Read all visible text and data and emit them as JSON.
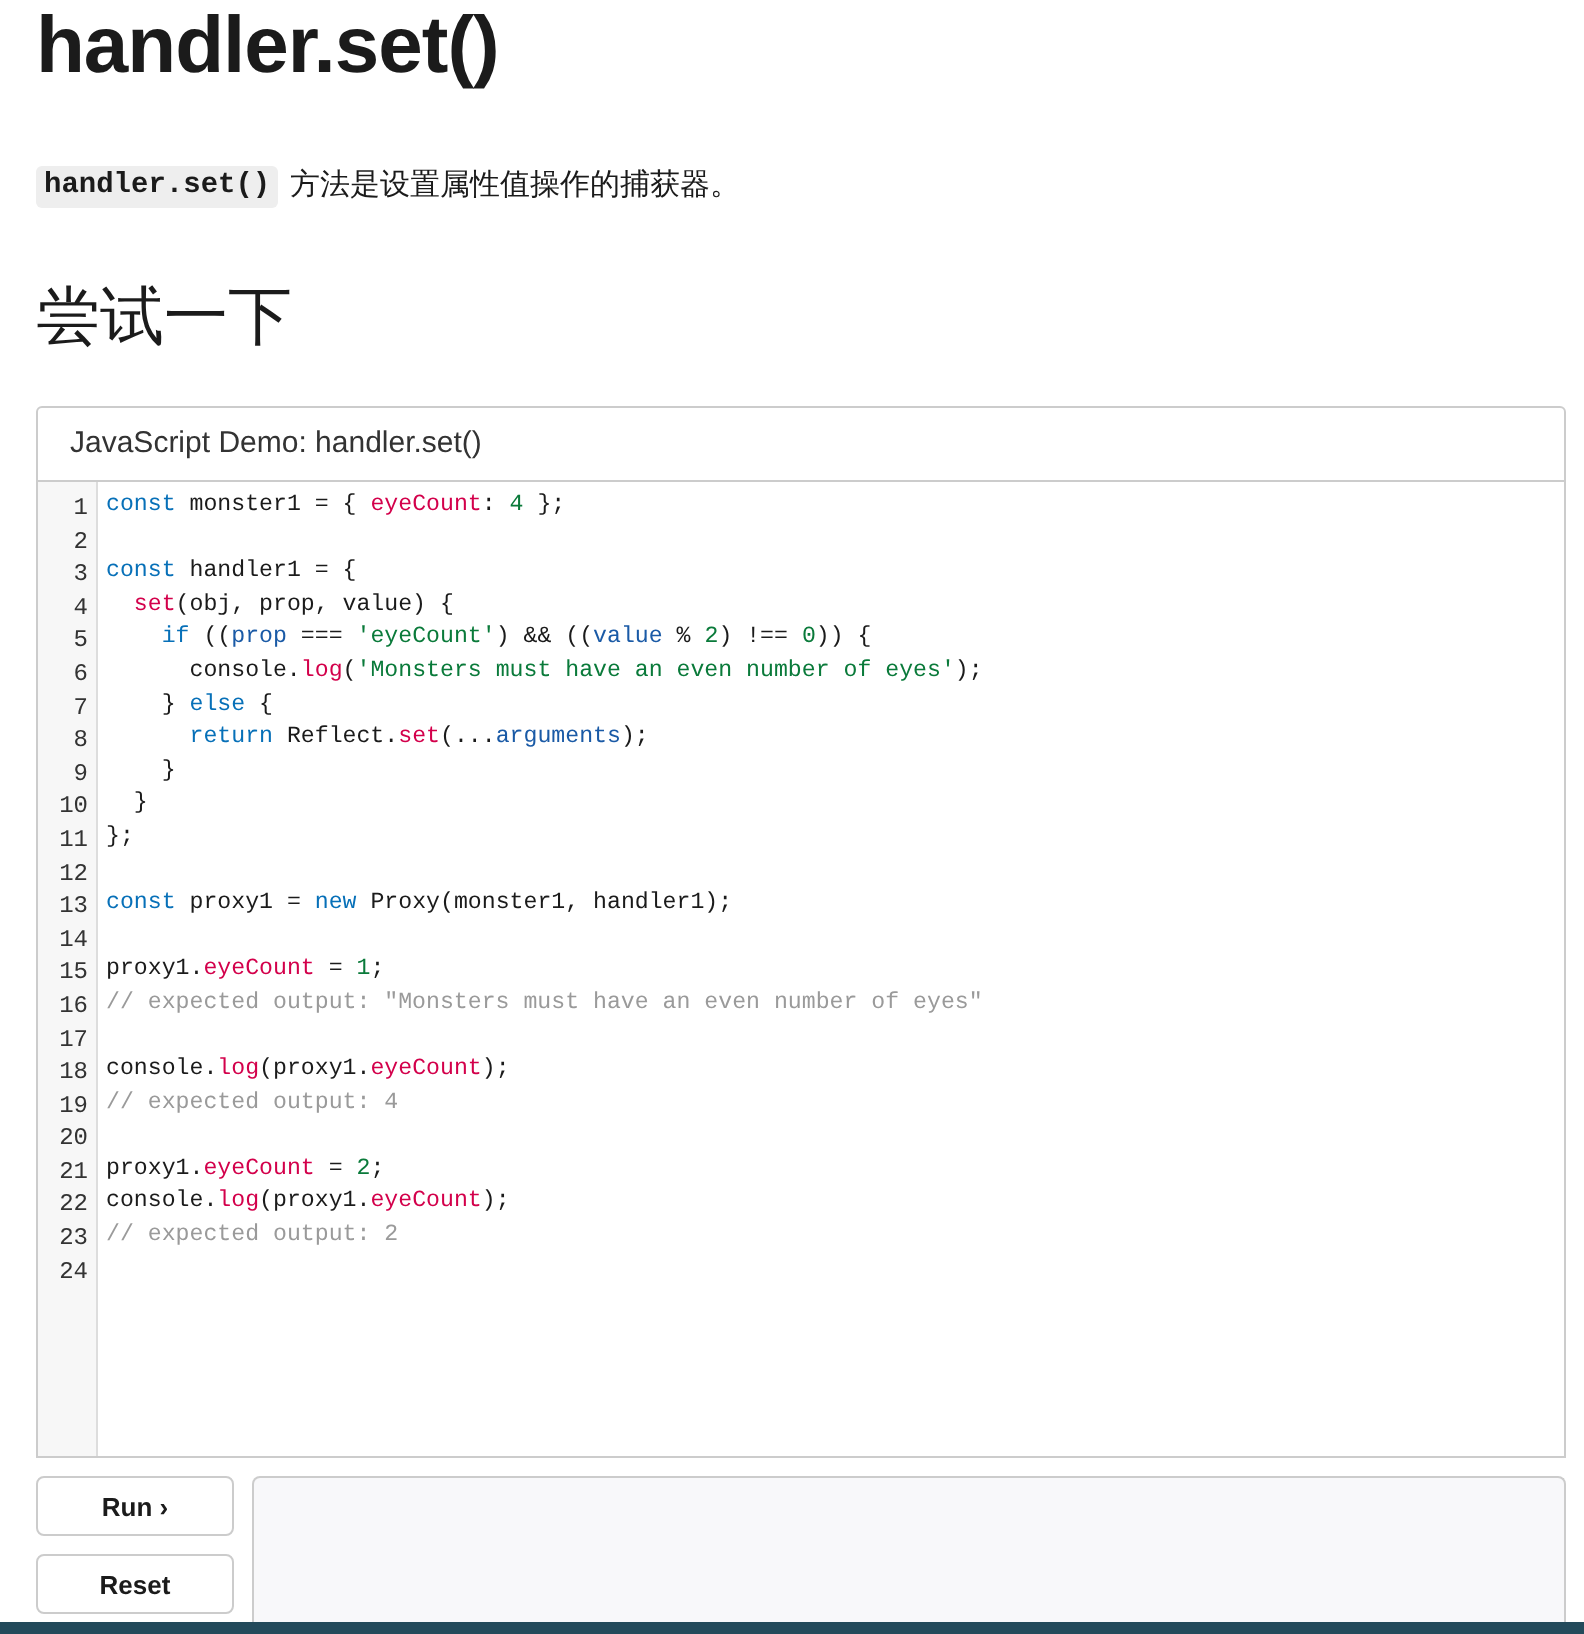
{
  "page_title": "handler.set()",
  "intro": {
    "code": "handler.set()",
    "text": "方法是设置属性值操作的捕获器。"
  },
  "section_heading": "尝试一下",
  "demo": {
    "title": "JavaScript Demo: handler.set()",
    "lines": [
      {
        "number": "1",
        "tokens": [
          {
            "text": "const",
            "kind": "keyword"
          },
          {
            "text": " monster1 = { ",
            "kind": "plain"
          },
          {
            "text": "eyeCount",
            "kind": "property"
          },
          {
            "text": ": ",
            "kind": "plain"
          },
          {
            "text": "4",
            "kind": "number"
          },
          {
            "text": " };",
            "kind": "plain"
          }
        ]
      },
      {
        "number": "2"
      },
      {
        "number": "3",
        "tokens": [
          {
            "text": "const",
            "kind": "keyword"
          },
          {
            "text": " handler1 = {",
            "kind": "plain"
          }
        ]
      },
      {
        "number": "4",
        "tokens": [
          {
            "text": "  set",
            "kind": "property"
          },
          {
            "text": "(obj, prop, value) {",
            "kind": "plain"
          }
        ]
      },
      {
        "number": "5",
        "tokens": [
          {
            "text": "    if",
            "kind": "keyword"
          },
          {
            "text": " ((",
            "kind": "plain"
          },
          {
            "text": "prop",
            "kind": "variable"
          },
          {
            "text": " === ",
            "kind": "plain"
          },
          {
            "text": "'eyeCount'",
            "kind": "string"
          },
          {
            "text": ") && ((",
            "kind": "plain"
          },
          {
            "text": "value",
            "kind": "variable"
          },
          {
            "text": " % ",
            "kind": "plain"
          },
          {
            "text": "2",
            "kind": "number"
          },
          {
            "text": ") !== ",
            "kind": "plain"
          },
          {
            "text": "0",
            "kind": "number"
          },
          {
            "text": ")) {",
            "kind": "plain"
          }
        ]
      },
      {
        "number": "6",
        "tokens": [
          {
            "text": "      console.",
            "kind": "plain"
          },
          {
            "text": "log",
            "kind": "property"
          },
          {
            "text": "(",
            "kind": "plain"
          },
          {
            "text": "'Monsters must have an even number of eyes'",
            "kind": "string"
          },
          {
            "text": ");",
            "kind": "plain"
          }
        ]
      },
      {
        "number": "7",
        "tokens": [
          {
            "text": "    } ",
            "kind": "plain"
          },
          {
            "text": "else",
            "kind": "keyword"
          },
          {
            "text": " {",
            "kind": "plain"
          }
        ]
      },
      {
        "number": "8",
        "tokens": [
          {
            "text": "      return",
            "kind": "keyword"
          },
          {
            "text": " Reflect.",
            "kind": "plain"
          },
          {
            "text": "set",
            "kind": "property"
          },
          {
            "text": "(...",
            "kind": "plain"
          },
          {
            "text": "arguments",
            "kind": "variable"
          },
          {
            "text": ");",
            "kind": "plain"
          }
        ]
      },
      {
        "number": "9",
        "tokens": [
          {
            "text": "    }",
            "kind": "plain"
          }
        ]
      },
      {
        "number": "10",
        "tokens": [
          {
            "text": "  }",
            "kind": "plain"
          }
        ]
      },
      {
        "number": "11",
        "tokens": [
          {
            "text": "};",
            "kind": "plain"
          }
        ]
      },
      {
        "number": "12"
      },
      {
        "number": "13",
        "tokens": [
          {
            "text": "const",
            "kind": "keyword"
          },
          {
            "text": " proxy1 = ",
            "kind": "plain"
          },
          {
            "text": "new",
            "kind": "keyword"
          },
          {
            "text": " Proxy(monster1, handler1);",
            "kind": "plain"
          }
        ]
      },
      {
        "number": "14"
      },
      {
        "number": "15",
        "tokens": [
          {
            "text": "proxy1.",
            "kind": "plain"
          },
          {
            "text": "eyeCount",
            "kind": "property"
          },
          {
            "text": " = ",
            "kind": "plain"
          },
          {
            "text": "1",
            "kind": "number"
          },
          {
            "text": ";",
            "kind": "plain"
          }
        ]
      },
      {
        "number": "16",
        "tokens": [
          {
            "text": "// expected output: \"Monsters must have an even number of eyes\"",
            "kind": "comment"
          }
        ]
      },
      {
        "number": "17"
      },
      {
        "number": "18",
        "tokens": [
          {
            "text": "console.",
            "kind": "plain"
          },
          {
            "text": "log",
            "kind": "property"
          },
          {
            "text": "(proxy1.",
            "kind": "plain"
          },
          {
            "text": "eyeCount",
            "kind": "property"
          },
          {
            "text": ");",
            "kind": "plain"
          }
        ]
      },
      {
        "number": "19",
        "tokens": [
          {
            "text": "// expected output: 4",
            "kind": "comment"
          }
        ]
      },
      {
        "number": "20"
      },
      {
        "number": "21",
        "tokens": [
          {
            "text": "proxy1.",
            "kind": "plain"
          },
          {
            "text": "eyeCount",
            "kind": "property"
          },
          {
            "text": " = ",
            "kind": "plain"
          },
          {
            "text": "2",
            "kind": "number"
          },
          {
            "text": ";",
            "kind": "plain"
          }
        ]
      },
      {
        "number": "22",
        "tokens": [
          {
            "text": "console.",
            "kind": "plain"
          },
          {
            "text": "log",
            "kind": "property"
          },
          {
            "text": "(proxy1.",
            "kind": "plain"
          },
          {
            "text": "eyeCount",
            "kind": "property"
          },
          {
            "text": ");",
            "kind": "plain"
          }
        ]
      },
      {
        "number": "23",
        "tokens": [
          {
            "text": "// expected output: 2",
            "kind": "comment"
          }
        ]
      },
      {
        "number": "24"
      }
    ]
  },
  "buttons": [
    {
      "label": "Run ›"
    },
    {
      "label": "Reset"
    }
  ]
}
